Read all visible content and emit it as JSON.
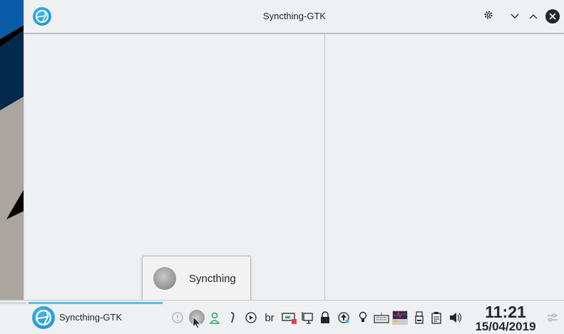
{
  "window": {
    "title": "Syncthing-GTK",
    "accent": "#1a8fd0"
  },
  "titlebar_buttons": [
    {
      "name": "settings",
      "icon": "gear-icon"
    },
    {
      "name": "minimize",
      "icon": "chevron-down-icon"
    },
    {
      "name": "maximize",
      "icon": "chevron-up-icon"
    },
    {
      "name": "close",
      "icon": "close-icon"
    }
  ],
  "tooltip": {
    "label": "Syncthing"
  },
  "taskbar": {
    "task_label": "Syncthing-GTK",
    "tray_text_item": "br",
    "clock": {
      "time": "11:21",
      "date": "15/04/2019"
    }
  }
}
